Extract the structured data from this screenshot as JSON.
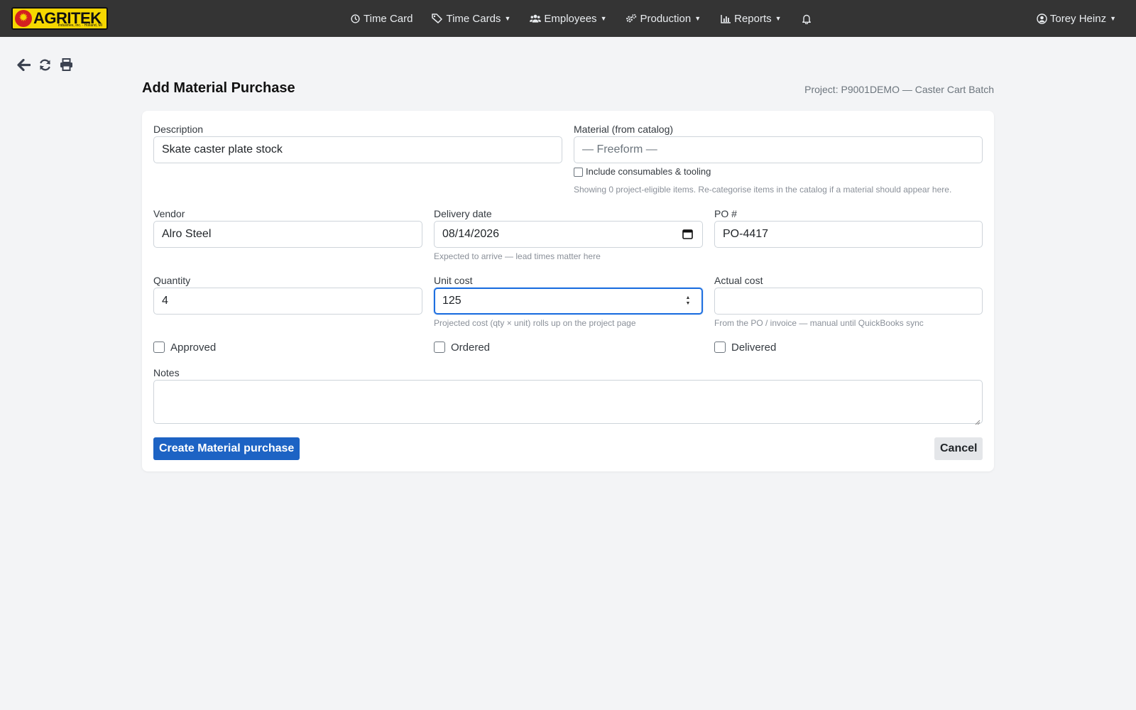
{
  "brand": {
    "name": "AGRITEK",
    "subtitle": "Industries, Inc. · Holland, MI"
  },
  "nav": {
    "items": [
      {
        "label": "Time Card",
        "icon": "clock-icon",
        "dropdown": false
      },
      {
        "label": "Time Cards",
        "icon": "tags-icon",
        "dropdown": true
      },
      {
        "label": "Employees",
        "icon": "users-icon",
        "dropdown": true
      },
      {
        "label": "Production",
        "icon": "cogs-icon",
        "dropdown": true
      },
      {
        "label": "Reports",
        "icon": "bar-chart-icon",
        "dropdown": true
      }
    ],
    "bell_icon": "bell-icon",
    "user": {
      "name": "Torey Heinz",
      "icon": "user-circle-icon"
    }
  },
  "toolbar": {
    "icons": [
      "back-arrow-icon",
      "refresh-icon",
      "print-icon"
    ]
  },
  "page": {
    "title": "Add Material Purchase",
    "project": "Project: P9001DEMO — Caster Cart Batch"
  },
  "form": {
    "description": {
      "label": "Description",
      "value": "Skate caster plate stock"
    },
    "material": {
      "label": "Material (from catalog)",
      "placeholder": "— Freeform —",
      "include_label": "Include consumables & tooling",
      "help": "Showing 0 project-eligible items. Re-categorise items in the catalog if a material should appear here."
    },
    "vendor": {
      "label": "Vendor",
      "value": "Alro Steel"
    },
    "delivery_date": {
      "label": "Delivery date",
      "value": "08/14/2026",
      "help": "Expected to arrive — lead times matter here"
    },
    "po": {
      "label": "PO #",
      "value": "PO-4417"
    },
    "quantity": {
      "label": "Quantity",
      "value": "4"
    },
    "unit_cost": {
      "label": "Unit cost",
      "value": "125",
      "help": "Projected cost (qty × unit) rolls up on the project page"
    },
    "actual_cost": {
      "label": "Actual cost",
      "value": "",
      "help": "From the PO / invoice — manual until QuickBooks sync"
    },
    "approved": {
      "label": "Approved",
      "checked": false
    },
    "ordered": {
      "label": "Ordered",
      "checked": false
    },
    "delivered": {
      "label": "Delivered",
      "checked": false
    },
    "notes": {
      "label": "Notes",
      "value": ""
    },
    "submit_label": "Create Material purchase",
    "cancel_label": "Cancel"
  },
  "colors": {
    "navbar": "#343434",
    "brand_yellow": "#f5d700",
    "primary": "#1d63c4",
    "focus": "#1e6fe0",
    "page_bg": "#f3f4f6"
  }
}
